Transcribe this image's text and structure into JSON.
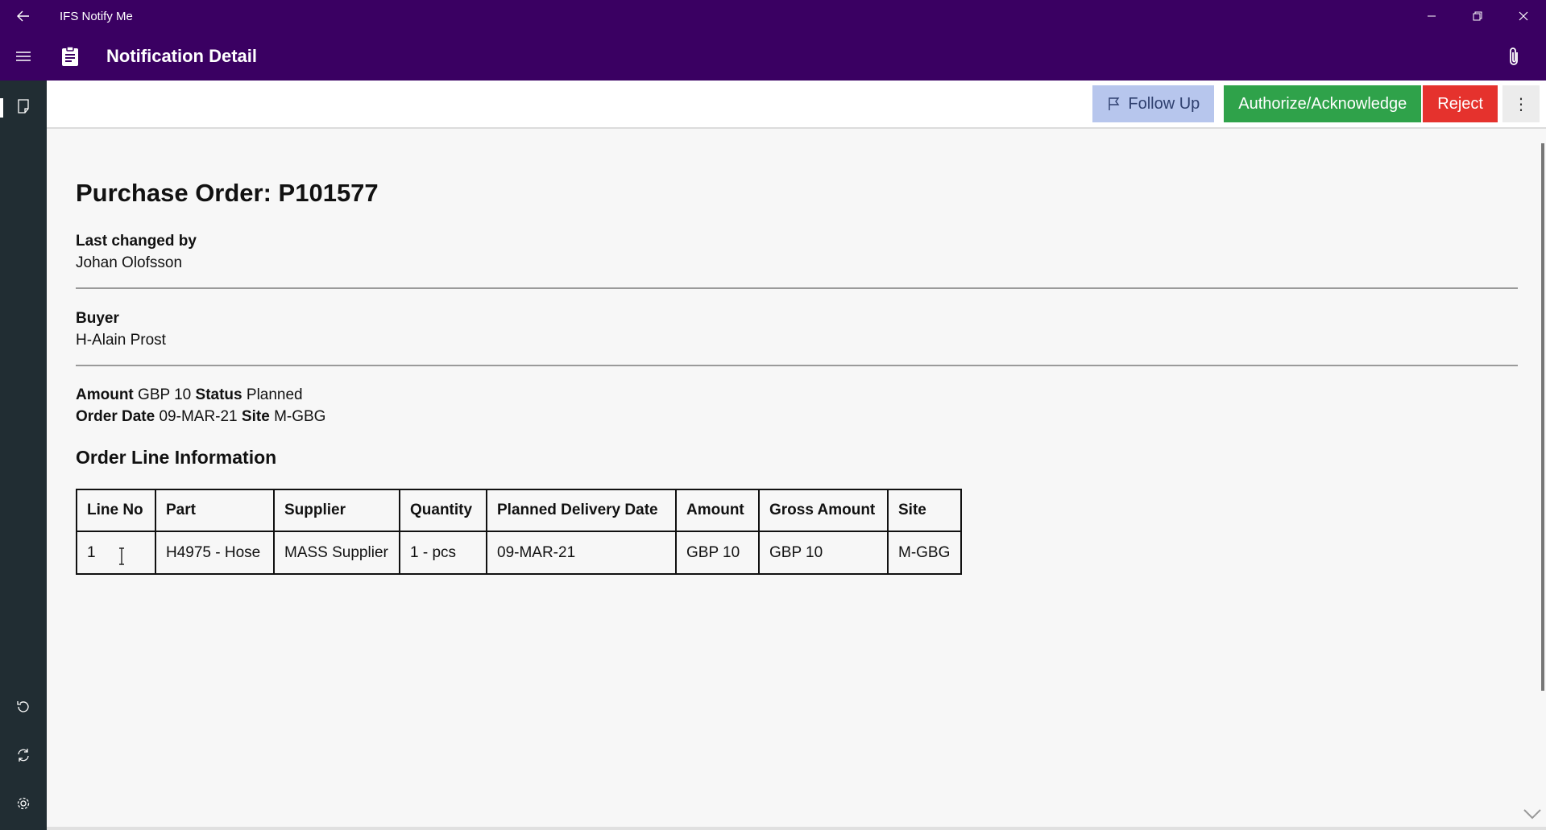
{
  "window": {
    "app_title": "IFS Notify Me",
    "icons": {
      "back": "back-arrow-icon",
      "minimize": "minimize-icon",
      "restore": "restore-icon",
      "close": "close-icon"
    }
  },
  "header": {
    "title": "Notification Detail",
    "icons": {
      "menu": "hamburger-icon",
      "page": "clipboard-icon",
      "attach": "paperclip-icon"
    }
  },
  "nav": {
    "items": [
      {
        "name": "notifications",
        "icon": "document-icon",
        "active": true
      },
      {
        "name": "history",
        "icon": "history-icon",
        "active": false
      },
      {
        "name": "sync",
        "icon": "sync-icon",
        "active": false
      },
      {
        "name": "settings",
        "icon": "gear-icon",
        "active": false
      }
    ]
  },
  "commands": {
    "follow_up": "Follow Up",
    "authorize": "Authorize/Acknowledge",
    "reject": "Reject",
    "more": "⋮"
  },
  "colors": {
    "header_bg": "#3a0062",
    "rail_bg": "#212d33",
    "follow_up_bg": "#b7c6ed",
    "authorize_bg": "#2fa24a",
    "reject_bg": "#e5322d"
  },
  "detail": {
    "title": "Purchase Order: P101577",
    "last_changed_label": "Last changed by",
    "last_changed_value": "Johan Olofsson",
    "buyer_label": "Buyer",
    "buyer_value": "H-Alain Prost",
    "amount_label": "Amount",
    "amount_value": "GBP 10",
    "status_label": "Status",
    "status_value": "Planned",
    "order_date_label": "Order Date",
    "order_date_value": "09-MAR-21",
    "site_label": "Site",
    "site_value": "M-GBG",
    "section_title": "Order Line Information"
  },
  "table": {
    "headers": [
      "Line No",
      "Part",
      "Supplier",
      "Quantity",
      "Planned Delivery Date",
      "Amount",
      "Gross Amount",
      "Site"
    ],
    "rows": [
      [
        "1",
        "H4975 - Hose",
        "MASS Supplier",
        "1 - pcs",
        "09-MAR-21",
        "GBP 10",
        "GBP 10",
        "M-GBG"
      ]
    ]
  }
}
